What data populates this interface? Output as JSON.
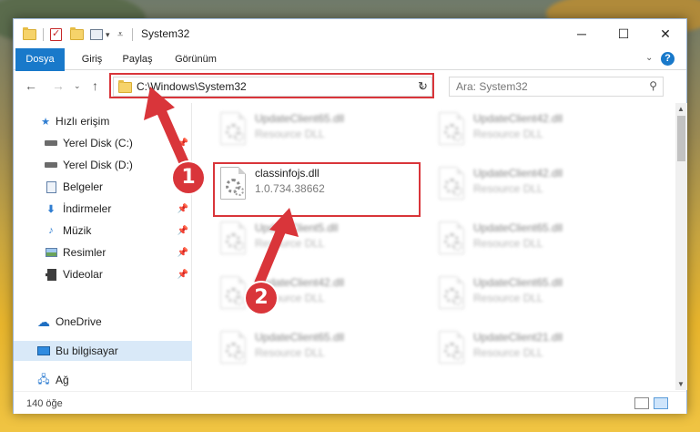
{
  "window": {
    "title": "System32"
  },
  "ribbon": {
    "tabs": [
      {
        "label": "Dosya"
      },
      {
        "label": "Giriş"
      },
      {
        "label": "Paylaş"
      },
      {
        "label": "Görünüm"
      }
    ]
  },
  "address": {
    "path": "C:\\Windows\\System32"
  },
  "search": {
    "placeholder": "Ara: System32"
  },
  "sidebar": {
    "items": [
      {
        "label": "Hızlı erişim",
        "icon": "star-icon"
      },
      {
        "label": "Yerel Disk (C:)",
        "icon": "drive-icon"
      },
      {
        "label": "Yerel Disk (D:)",
        "icon": "drive-icon"
      },
      {
        "label": "Belgeler",
        "icon": "document-icon"
      },
      {
        "label": "İndirmeler",
        "icon": "download-icon"
      },
      {
        "label": "Müzik",
        "icon": "music-icon"
      },
      {
        "label": "Resimler",
        "icon": "pictures-icon"
      },
      {
        "label": "Videolar",
        "icon": "video-icon"
      },
      {
        "label": "OneDrive",
        "icon": "cloud-icon"
      },
      {
        "label": "Bu bilgisayar",
        "icon": "computer-icon"
      },
      {
        "label": "Ağ",
        "icon": "network-icon"
      }
    ]
  },
  "files": [
    {
      "name": "UpdateClient65.dll",
      "desc": "Resource DLL"
    },
    {
      "name": "UpdateClient42.dll",
      "desc": "Resource DLL"
    },
    {
      "name": "classinfojs.dll",
      "desc": "1.0.734.38662"
    },
    {
      "name": "UpdateClient42.dll",
      "desc": "Resource DLL"
    },
    {
      "name": "UpdateClient5.dll",
      "desc": "Resource DLL"
    },
    {
      "name": "UpdateClient65.dll",
      "desc": "Resource DLL"
    },
    {
      "name": "UpdateClient42.dll",
      "desc": "Resource DLL"
    },
    {
      "name": "UpdateClient65.dll",
      "desc": "Resource DLL"
    },
    {
      "name": "UpdateClient65.dll",
      "desc": "Resource DLL"
    },
    {
      "name": "UpdateClient21.dll",
      "desc": "Resource DLL"
    }
  ],
  "status": {
    "count": "140 öğe"
  },
  "annotations": {
    "step1": "1",
    "step2": "2",
    "color": "#d9353a"
  }
}
